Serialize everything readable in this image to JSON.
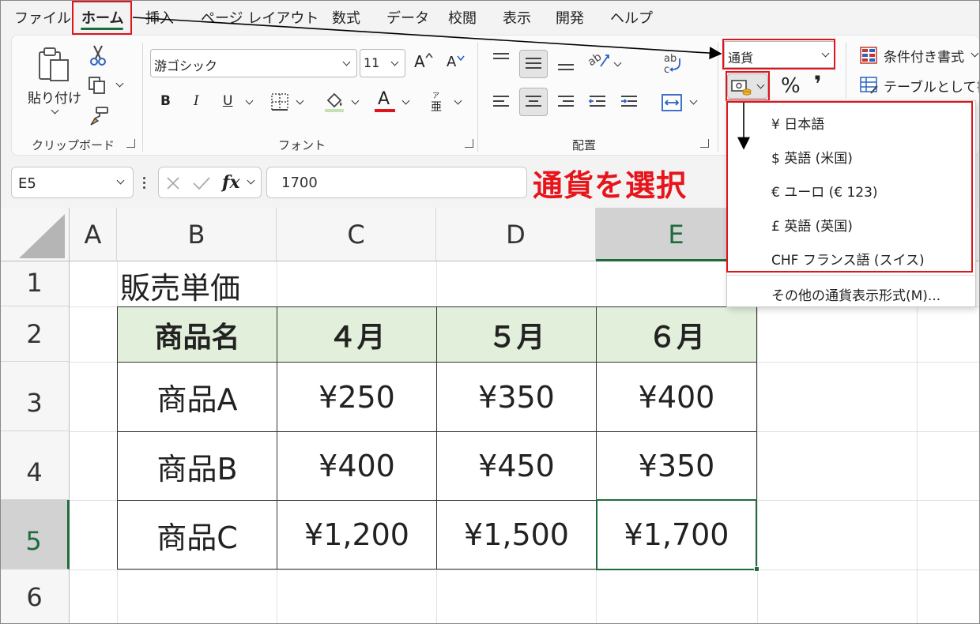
{
  "menu": {
    "tabs": [
      "ファイル",
      "ホーム",
      "挿入",
      "ページ レイアウト",
      "数式",
      "データ",
      "校閲",
      "表示",
      "開発",
      "ヘルプ"
    ],
    "active": "ホーム"
  },
  "ribbon": {
    "clipboard": {
      "paste_label": "貼り付け",
      "group_label": "クリップボード"
    },
    "font": {
      "name": "游ゴシック",
      "size": "11",
      "group_label": "フォント",
      "bold": "B",
      "italic": "I",
      "underline": "U",
      "grow": "A",
      "shrink": "A",
      "color_letter": "A",
      "phonetic": "亜"
    },
    "alignment": {
      "group_label": "配置"
    },
    "number": {
      "format_value": "通貨",
      "percent": "%",
      "comma": "❜"
    },
    "styles": {
      "conditional_format": "条件付き書式",
      "format_table": "テーブルとして書式"
    }
  },
  "formula_bar": {
    "name_box": "E5",
    "fx": "fx",
    "value": "1700"
  },
  "currency_menu": {
    "items": [
      "¥ 日本語",
      "$ 英語 (米国)",
      "€ ユーロ (€ 123)",
      "£ 英語 (英国)",
      "CHF フランス語 (スイス)"
    ],
    "more": "その他の通貨表示形式(M)..."
  },
  "annotation": "通貨を選択",
  "sheet": {
    "columns": [
      "A",
      "B",
      "C",
      "D",
      "E"
    ],
    "selected_column": "E",
    "rows": [
      "1",
      "2",
      "3",
      "4",
      "5",
      "6"
    ],
    "selected_row": "5",
    "title": "販売単価",
    "headers": [
      "商品名",
      "４月",
      "５月",
      "６月"
    ],
    "data": [
      [
        "商品A",
        "¥250",
        "¥350",
        "¥400"
      ],
      [
        "商品B",
        "¥400",
        "¥450",
        "¥350"
      ],
      [
        "商品C",
        "¥1,200",
        "¥1,500",
        "¥1,700"
      ]
    ]
  },
  "colors": {
    "accent": "#1e6b3b",
    "highlight_red": "#e0141b",
    "header_fill": "#e2efda"
  }
}
